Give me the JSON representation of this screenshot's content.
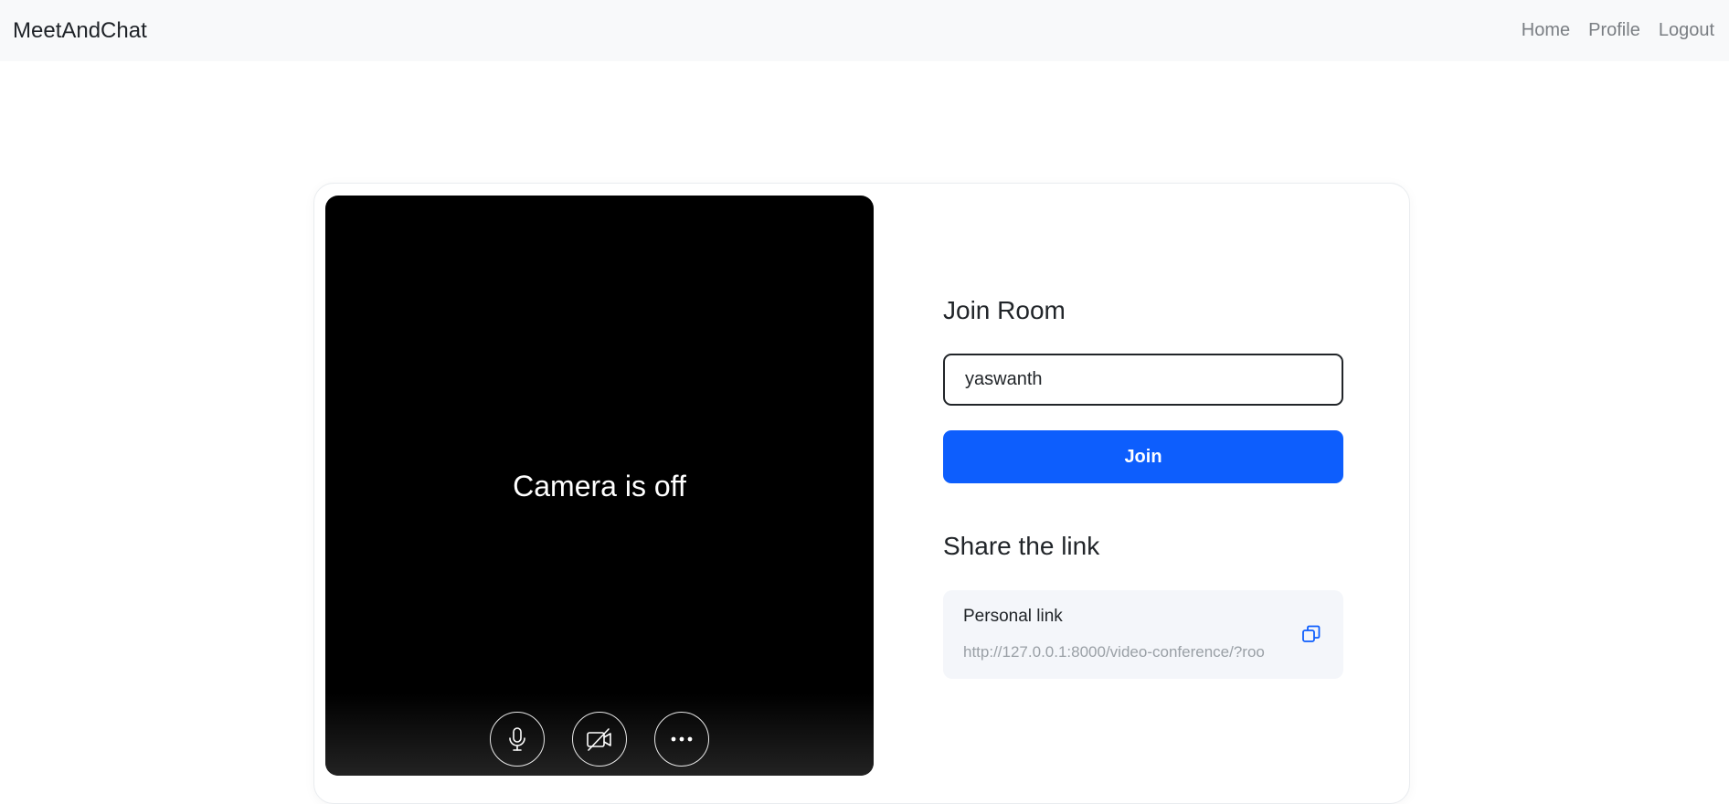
{
  "navbar": {
    "brand": "MeetAndChat",
    "links": [
      {
        "label": "Home"
      },
      {
        "label": "Profile"
      },
      {
        "label": "Logout"
      }
    ]
  },
  "video": {
    "status_text": "Camera is off",
    "controls": [
      {
        "icon": "microphone-icon"
      },
      {
        "icon": "camera-off-icon"
      },
      {
        "icon": "more-options-icon"
      }
    ]
  },
  "join": {
    "heading": "Join Room",
    "name_value": "yaswanth",
    "join_label": "Join"
  },
  "share": {
    "heading": "Share the link",
    "link_label": "Personal link",
    "link_url": "http://127.0.0.1:8000/video-conference/?roo",
    "copy_icon": "copy-icon"
  },
  "colors": {
    "accent": "#0d5efd",
    "navbar_bg": "#f8f9fa",
    "video_bg": "#000000",
    "link_box_bg": "#f4f6fa"
  }
}
